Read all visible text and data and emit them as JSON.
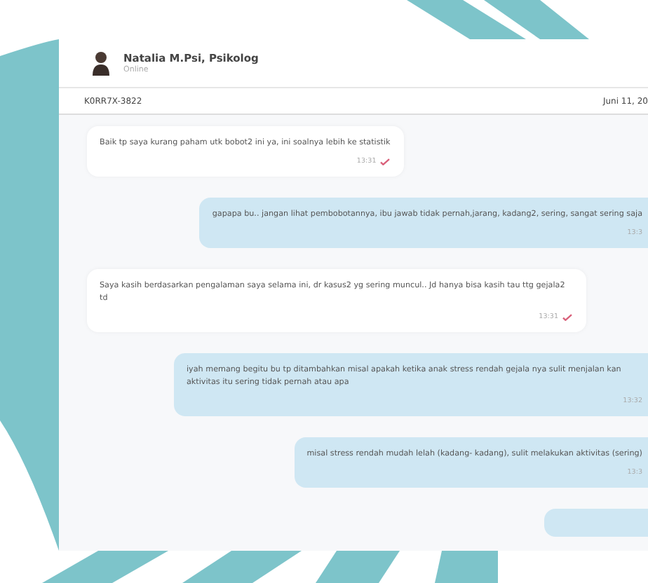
{
  "header": {
    "name": "Natalia M.Psi, Psikolog",
    "status": "Online"
  },
  "info_bar": {
    "code": "K0RR7X-3822",
    "date": "Juni 11, 20"
  },
  "messages": [
    {
      "kind": "incoming",
      "text": "Baik tp saya kurang paham utk bobot2 ini ya, ini soalnya lebih ke statistik",
      "time": "13:31",
      "read": true
    },
    {
      "kind": "outgoing",
      "text": "gapapa bu.. jangan lihat pembobotannya, ibu jawab tidak pernah,jarang, kadang2, sering, sangat sering saja",
      "time": "13:3"
    },
    {
      "kind": "incoming",
      "text": "Saya kasih berdasarkan pengalaman saya selama ini, dr kasus2 yg sering muncul.. Jd hanya bisa kasih tau ttg gejala2 td",
      "time": "13:31",
      "read": true
    },
    {
      "kind": "outgoing",
      "text": "iyah memang begitu bu tp ditambahkan misal apakah ketika anak stress rendah gejala nya sulit menjalan kan aktivitas itu sering tidak pernah atau apa",
      "time": "13:32"
    },
    {
      "kind": "outgoing",
      "text": "misal stress rendah mudah lelah (kadang- kadang), sulit melakukan aktivitas (sering)",
      "time": "13:3"
    }
  ],
  "more_below": true
}
